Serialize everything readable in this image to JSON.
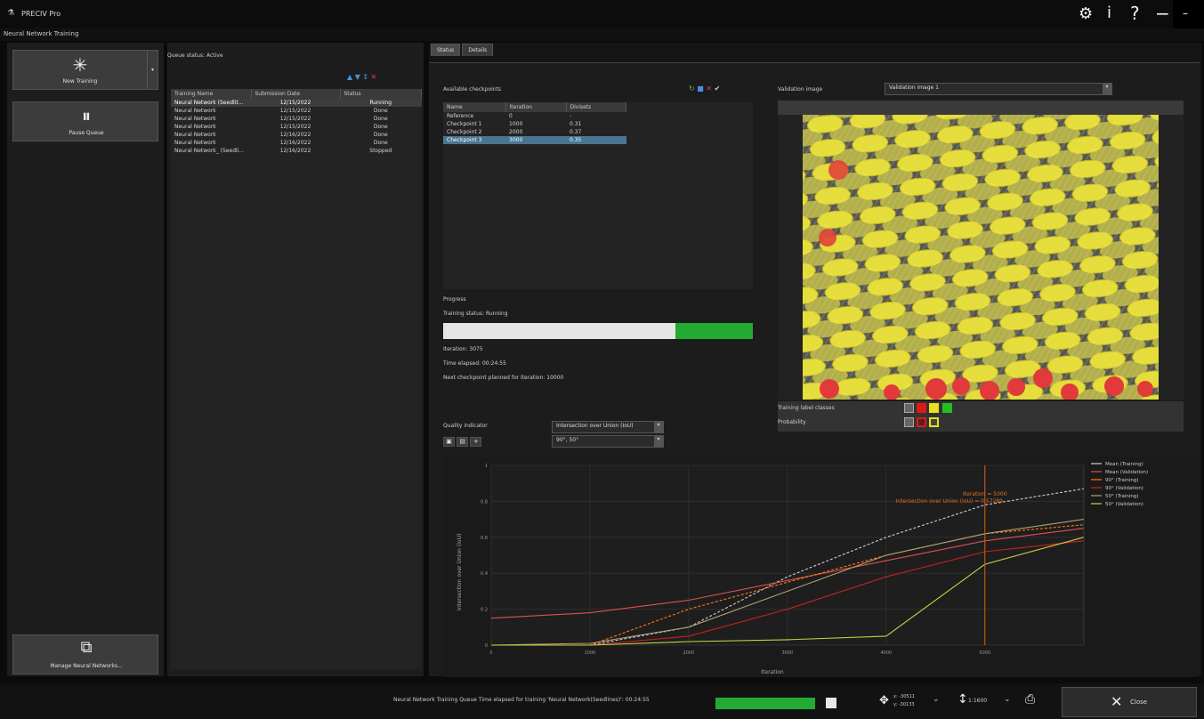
{
  "window": {
    "title": "PRECIV Pro",
    "controls": [
      "⚙",
      "i",
      "?",
      "−",
      "–"
    ]
  },
  "menu": {
    "title": "Neural Network Training"
  },
  "left": {
    "new_training": "New Training",
    "pause_queue": "Pause Queue",
    "manage": "Manage Neural Networks..."
  },
  "queue": {
    "status": "Queue status: Active",
    "columns": [
      "Training Name",
      "Submission Date",
      "Status"
    ],
    "rows": [
      [
        "Neural Network (Seedlit...",
        "12/15/2022",
        "Running"
      ],
      [
        "Neural Network",
        "12/15/2022",
        "Done"
      ],
      [
        "Neural Network",
        "12/15/2022",
        "Done"
      ],
      [
        "Neural Network",
        "12/15/2022",
        "Done"
      ],
      [
        "Neural Network",
        "12/16/2022",
        "Done"
      ],
      [
        "Neural Network",
        "12/16/2022",
        "Done"
      ],
      [
        "Neural Network_ (Seedli...",
        "12/16/2022",
        "Stopped"
      ]
    ]
  },
  "tabs": [
    "Status",
    "Details"
  ],
  "checkpoints": {
    "label": "Available checkpoints",
    "columns": [
      "Name",
      "Iteration",
      "Divisets"
    ],
    "rows": [
      [
        "Reference",
        "0",
        "-"
      ],
      [
        "Checkpoint 1",
        "1000",
        "0.31"
      ],
      [
        "Checkpoint 2",
        "2000",
        "0.37"
      ],
      [
        "Checkpoint 3",
        "3000",
        "0.35"
      ]
    ],
    "selected_index": 3
  },
  "progress": {
    "label": "Progress",
    "status": "Training status: Running",
    "fraction": 0.75,
    "iteration": "Iteration: 3075",
    "elapsed": "Time elapsed: 00:24:55",
    "next": "Next checkpoint planned for iteration: 10000"
  },
  "quality": {
    "label": "Quality indicator",
    "metric": "Intersection over Union (IoU)",
    "filter": "90°, 50°"
  },
  "validation": {
    "label": "Validation image",
    "value": "Validation image 1",
    "training_label": "Training label classes",
    "probability": "Probability",
    "class_colors": [
      "#e01818",
      "#e8e020",
      "#20c020"
    ]
  },
  "chart_data": {
    "type": "line",
    "xlabel": "Iteration",
    "ylabel": "Intersection over Union (IoU)",
    "xlim": [
      0,
      5000
    ],
    "ylim": [
      0,
      1
    ],
    "x_ticks": [
      "0",
      "1000",
      "2000",
      "3000",
      "4000",
      "5000"
    ],
    "y_ticks": [
      "0",
      "0.2",
      "0.4",
      "0.6",
      "0.8",
      "1"
    ],
    "marker": {
      "x": 5000,
      "label1": "Iteration = 5000",
      "label2": "Intersection over Union (IoU) = 0.57289"
    },
    "series": [
      {
        "name": "Mean (Training)",
        "color": "#cfcfcf",
        "x": [
          0,
          1000,
          2000,
          3000,
          4000,
          5000,
          6000
        ],
        "y": [
          0.0,
          0.0,
          0.1,
          0.38,
          0.6,
          0.78,
          0.87
        ]
      },
      {
        "name": "Mean (Validation)",
        "color": "#e05050",
        "x": [
          0,
          1000,
          2000,
          3000,
          4000,
          5000,
          6000
        ],
        "y": [
          0.15,
          0.18,
          0.25,
          0.36,
          0.47,
          0.58,
          0.65
        ]
      },
      {
        "name": "90° (Training)",
        "color": "#ff7a10",
        "x": [
          0,
          1000,
          2000,
          3000,
          4000,
          5000,
          6000
        ],
        "y": [
          0.0,
          0.0,
          0.2,
          0.35,
          0.5,
          0.62,
          0.67
        ]
      },
      {
        "name": "90° (Validation)",
        "color": "#c82020",
        "x": [
          0,
          1000,
          2000,
          3000,
          4000,
          5000,
          6000
        ],
        "y": [
          0.0,
          0.0,
          0.05,
          0.2,
          0.38,
          0.52,
          0.58
        ]
      },
      {
        "name": "50° (Training)",
        "color": "#b0a070",
        "x": [
          0,
          1000,
          2000,
          3000,
          4000,
          5000,
          6000
        ],
        "y": [
          0.0,
          0.01,
          0.1,
          0.3,
          0.5,
          0.62,
          0.7
        ]
      },
      {
        "name": "50° (Validation)",
        "color": "#c8d040",
        "x": [
          0,
          1000,
          2000,
          3000,
          4000,
          5000,
          6000
        ],
        "y": [
          0.0,
          0.0,
          0.02,
          0.03,
          0.05,
          0.45,
          0.6
        ]
      }
    ]
  },
  "footer": {
    "status": "Neural Network Training Queue Time elapsed for training 'Neural Network(Seedlines)': 00:24:55",
    "progress_fraction": 1.0,
    "coord_x": "x: -30511",
    "coord_y": "y: -30133",
    "zoom": "1:1600",
    "close": "Close"
  }
}
